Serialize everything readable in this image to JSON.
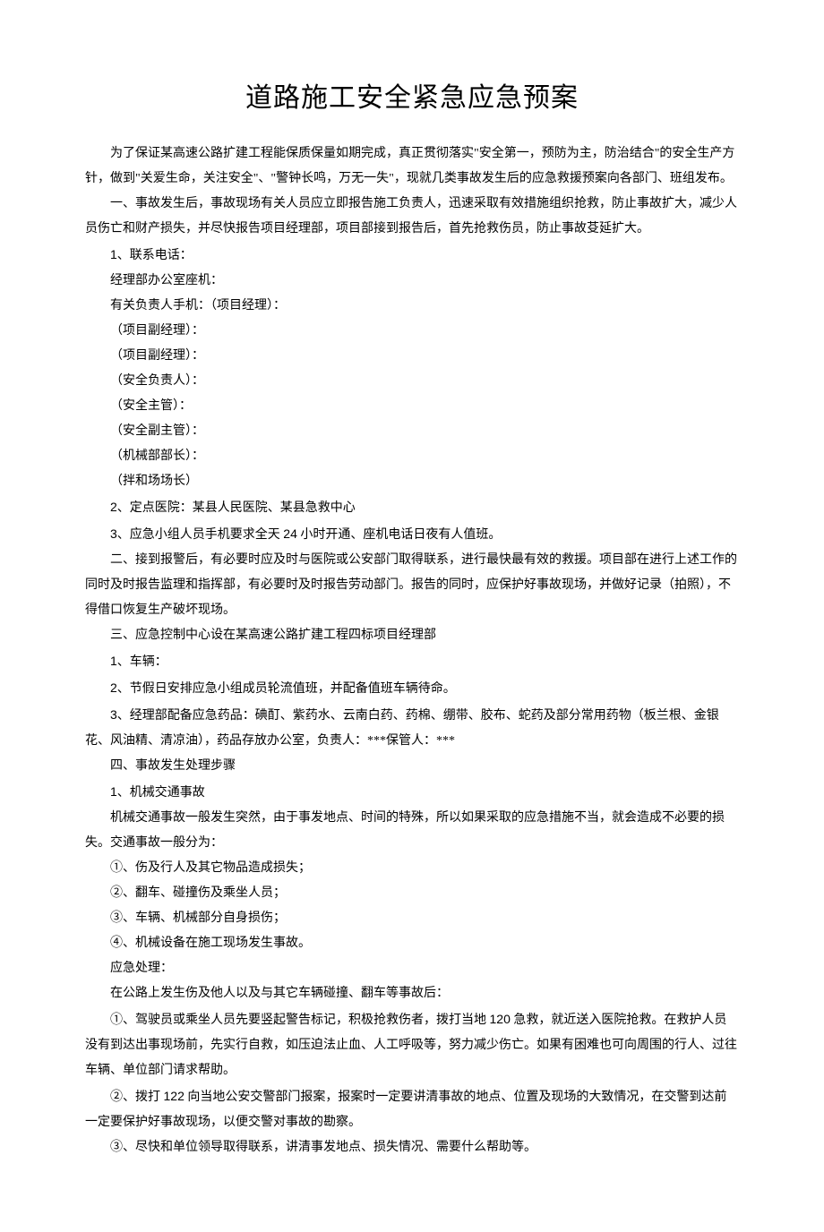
{
  "title": "道路施工安全紧急应急预案",
  "intro": "为了保证某高速公路扩建工程能保质保量如期完成，真正贯彻落实\"安全第一，预防为主，防治结合\"的安全生产方针，做到\"关爱生命，关注安全\"、\"警钟长鸣，万无一失\"，现就几类事故发生后的应急救援预案向各部门、班组发布。",
  "section1": {
    "heading": "一、事故发生后，事故现场有关人员应立即报告施工负责人，迅速采取有效措施组织抢救，防止事故扩大，减少人员伤亡和财产损失，并尽快报告项目经理部，项目部接到报告后，首先抢救伤员，防止事故芟延扩大。",
    "item1_prefix": "1",
    "item1_text": "、联系电话：",
    "contacts": {
      "office": "经理部办公室座机：",
      "pm": "有关负责人手机：（项目经理）：",
      "deputy1": "（项目副经理）：",
      "deputy2": "（项目副经理）：",
      "safety_lead": "（安全负责人）：",
      "safety_mgr": "（安全主管）：",
      "safety_deputy": "（安全副主管）：",
      "mech_head": "（机械部部长）：",
      "mix_head": "（拌和场场长）"
    },
    "item2_prefix": "2",
    "item2_text": "、定点医院：某县人民医院、某县急救中心",
    "item3_prefix": "3",
    "item3_text_a": "、应急小组人员手机要求全天 ",
    "item3_num": "24",
    "item3_text_b": " 小时开通、座机电话日夜有人值班。"
  },
  "section2": "二、接到报警后，有必要时应及时与医院或公安部门取得联系，进行最快最有效的救援。项目部在进行上述工作的同时及时报告监理和指挥部，有必要时及时报告劳动部门。报告的同时，应保护好事故现场，并做好记录（拍照），不得借口恢复生产破坏现场。",
  "section3": {
    "heading": "三、应急控制中心设在某高速公路扩建工程四标项目经理部",
    "item1_prefix": "1",
    "item1_text": "、车辆：",
    "item2_prefix": "2",
    "item2_text": "、节假日安排应急小组成员轮流值班，并配备值班车辆待命。",
    "item3_prefix": "3",
    "item3_text": "、经理部配备应急药品：碘酊、紫药水、云南白药、药棉、绷带、胶布、蛇药及部分常用药物（板兰根、金银花、风油精、清凉油），药品存放办公室，负责人：***保管人：***"
  },
  "section4": {
    "heading": "四、事故发生处理步骤",
    "item1_prefix": "1",
    "item1_text": "、机械交通事故",
    "desc": "机械交通事故一般发生突然，由于事发地点、时间的特殊，所以如果采取的应急措施不当，就会造成不必要的损失。交通事故一般分为：",
    "c1": "①、伤及行人及其它物品造成损失；",
    "c2": "②、翻车、碰撞伤及乘坐人员；",
    "c3": "③、车辆、机械部分自身损伤；",
    "c4": "④、机械设备在施工现场发生事故。",
    "resp_heading": "应急处理：",
    "resp_intro": "在公路上发生伤及他人以及与其它车辆碰撞、翻车等事故后：",
    "r1_a": "①、驾驶员或乘坐人员先要竖起警告标记，积极抢救伤者，拨打当地 ",
    "r1_num": "120",
    "r1_b": " 急救，就近送入医院抢救。在救护人员没有到达出事现场前，先实行自救，如压迫法止血、人工呼吸等，努力减少伤亡。如果有困难也可向周围的行人、过往车辆、单位部门请求帮助。",
    "r2_a": "②、拨打 ",
    "r2_num": "122",
    "r2_b": " 向当地公安交警部门报案，报案时一定要讲清事故的地点、位置及现场的大致情况，在交警到达前一定要保护好事故现场，以便交警对事故的勘察。",
    "r3": "③、尽快和单位领导取得联系，讲清事发地点、损失情况、需要什么帮助等。"
  }
}
